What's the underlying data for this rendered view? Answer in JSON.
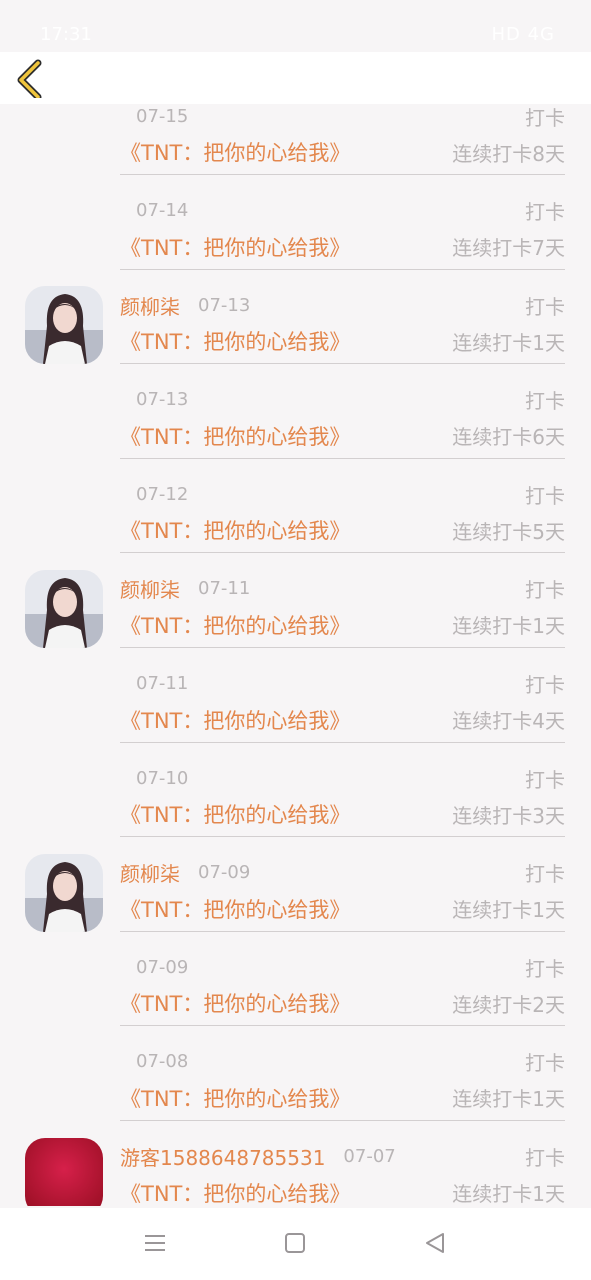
{
  "status_bar": {
    "time": "17:31",
    "right_indicators": "HD 4G"
  },
  "nav": {
    "back_icon": "chevron-left-icon",
    "accent_color": "#f0c53c"
  },
  "colors": {
    "accent": "#e3874d",
    "muted": "#b9b5b6",
    "divider": "#d3cfd0"
  },
  "items": [
    {
      "user": "",
      "avatar": "",
      "date": "07-15",
      "action": "打卡",
      "book": "《TNT：把你的心给我》",
      "streak": "连续打卡8天"
    },
    {
      "user": "",
      "avatar": "",
      "date": "07-14",
      "action": "打卡",
      "book": "《TNT：把你的心给我》",
      "streak": "连续打卡7天"
    },
    {
      "user": "颜柳柒",
      "avatar": "photo",
      "date": "07-13",
      "action": "打卡",
      "book": "《TNT：把你的心给我》",
      "streak": "连续打卡1天"
    },
    {
      "user": "",
      "avatar": "",
      "date": "07-13",
      "action": "打卡",
      "book": "《TNT：把你的心给我》",
      "streak": "连续打卡6天"
    },
    {
      "user": "",
      "avatar": "",
      "date": "07-12",
      "action": "打卡",
      "book": "《TNT：把你的心给我》",
      "streak": "连续打卡5天"
    },
    {
      "user": "颜柳柒",
      "avatar": "photo",
      "date": "07-11",
      "action": "打卡",
      "book": "《TNT：把你的心给我》",
      "streak": "连续打卡1天"
    },
    {
      "user": "",
      "avatar": "",
      "date": "07-11",
      "action": "打卡",
      "book": "《TNT：把你的心给我》",
      "streak": "连续打卡4天"
    },
    {
      "user": "",
      "avatar": "",
      "date": "07-10",
      "action": "打卡",
      "book": "《TNT：把你的心给我》",
      "streak": "连续打卡3天"
    },
    {
      "user": "颜柳柒",
      "avatar": "photo",
      "date": "07-09",
      "action": "打卡",
      "book": "《TNT：把你的心给我》",
      "streak": "连续打卡1天"
    },
    {
      "user": "",
      "avatar": "",
      "date": "07-09",
      "action": "打卡",
      "book": "《TNT：把你的心给我》",
      "streak": "连续打卡2天"
    },
    {
      "user": "",
      "avatar": "",
      "date": "07-08",
      "action": "打卡",
      "book": "《TNT：把你的心给我》",
      "streak": "连续打卡1天"
    },
    {
      "user": "游客1588648785531",
      "avatar": "red",
      "date": "07-07",
      "action": "打卡",
      "book": "《TNT：把你的心给我》",
      "streak": "连续打卡1天"
    }
  ],
  "bottom_nav": {
    "menu_icon": "menu-icon",
    "home_icon": "home-square-icon",
    "back_icon": "back-triangle-icon"
  }
}
